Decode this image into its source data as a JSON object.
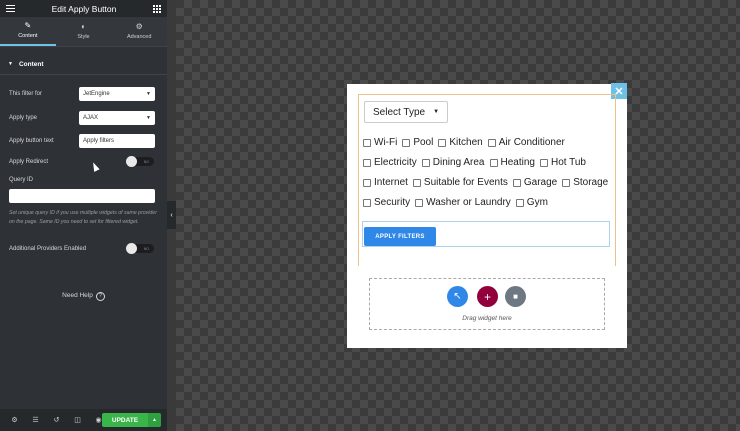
{
  "header": {
    "title": "Edit Apply Button"
  },
  "tabs": [
    {
      "label": "Content",
      "icon": "pencil-icon"
    },
    {
      "label": "Style",
      "icon": "half-circle-icon"
    },
    {
      "label": "Advanced",
      "icon": "gear-icon"
    }
  ],
  "section": {
    "title": "Content"
  },
  "fields": {
    "filter_for": {
      "label": "This filter for",
      "value": "JetEngine"
    },
    "apply_type": {
      "label": "Apply type",
      "value": "AJAX"
    },
    "apply_button_text": {
      "label": "Apply button text",
      "value": "Apply filters"
    },
    "apply_redirect": {
      "label": "Apply Redirect",
      "toggle": "NO"
    },
    "query_id": {
      "label": "Query ID",
      "value": "",
      "help": "Set unique query ID if you use multiple widgets of same provider on the page. Same ID you need to set for filtered widget."
    },
    "additional_providers": {
      "label": "Additional Providers Enabled",
      "toggle": "NO"
    }
  },
  "need_help": {
    "label": "Need Help",
    "icon": "question-icon"
  },
  "footer": {
    "icons": [
      "gear-icon",
      "layers-icon",
      "history-icon",
      "responsive-icon",
      "eye-icon"
    ],
    "update_label": "UPDATE"
  },
  "preview": {
    "select_placeholder": "Select Type",
    "checkbox_rows": [
      [
        "Wi-Fi",
        "Pool",
        "Kitchen",
        "Air Conditioner"
      ],
      [
        "Electricity",
        "Dining Area",
        "Heating",
        "Hot Tub"
      ],
      [
        "Internet",
        "Suitable for Events",
        "Garage",
        "Storage"
      ],
      [
        "Security",
        "Washer or Laundry",
        "Gym"
      ]
    ],
    "apply_button": "APPLY FILTERS",
    "drag_hint": "Drag widget here",
    "colors": {
      "accent": "#6ec1e4",
      "apply": "#2f87e8",
      "update": "#39b54a",
      "add_button": "#92003b",
      "folder_button": "#6d7882"
    }
  }
}
